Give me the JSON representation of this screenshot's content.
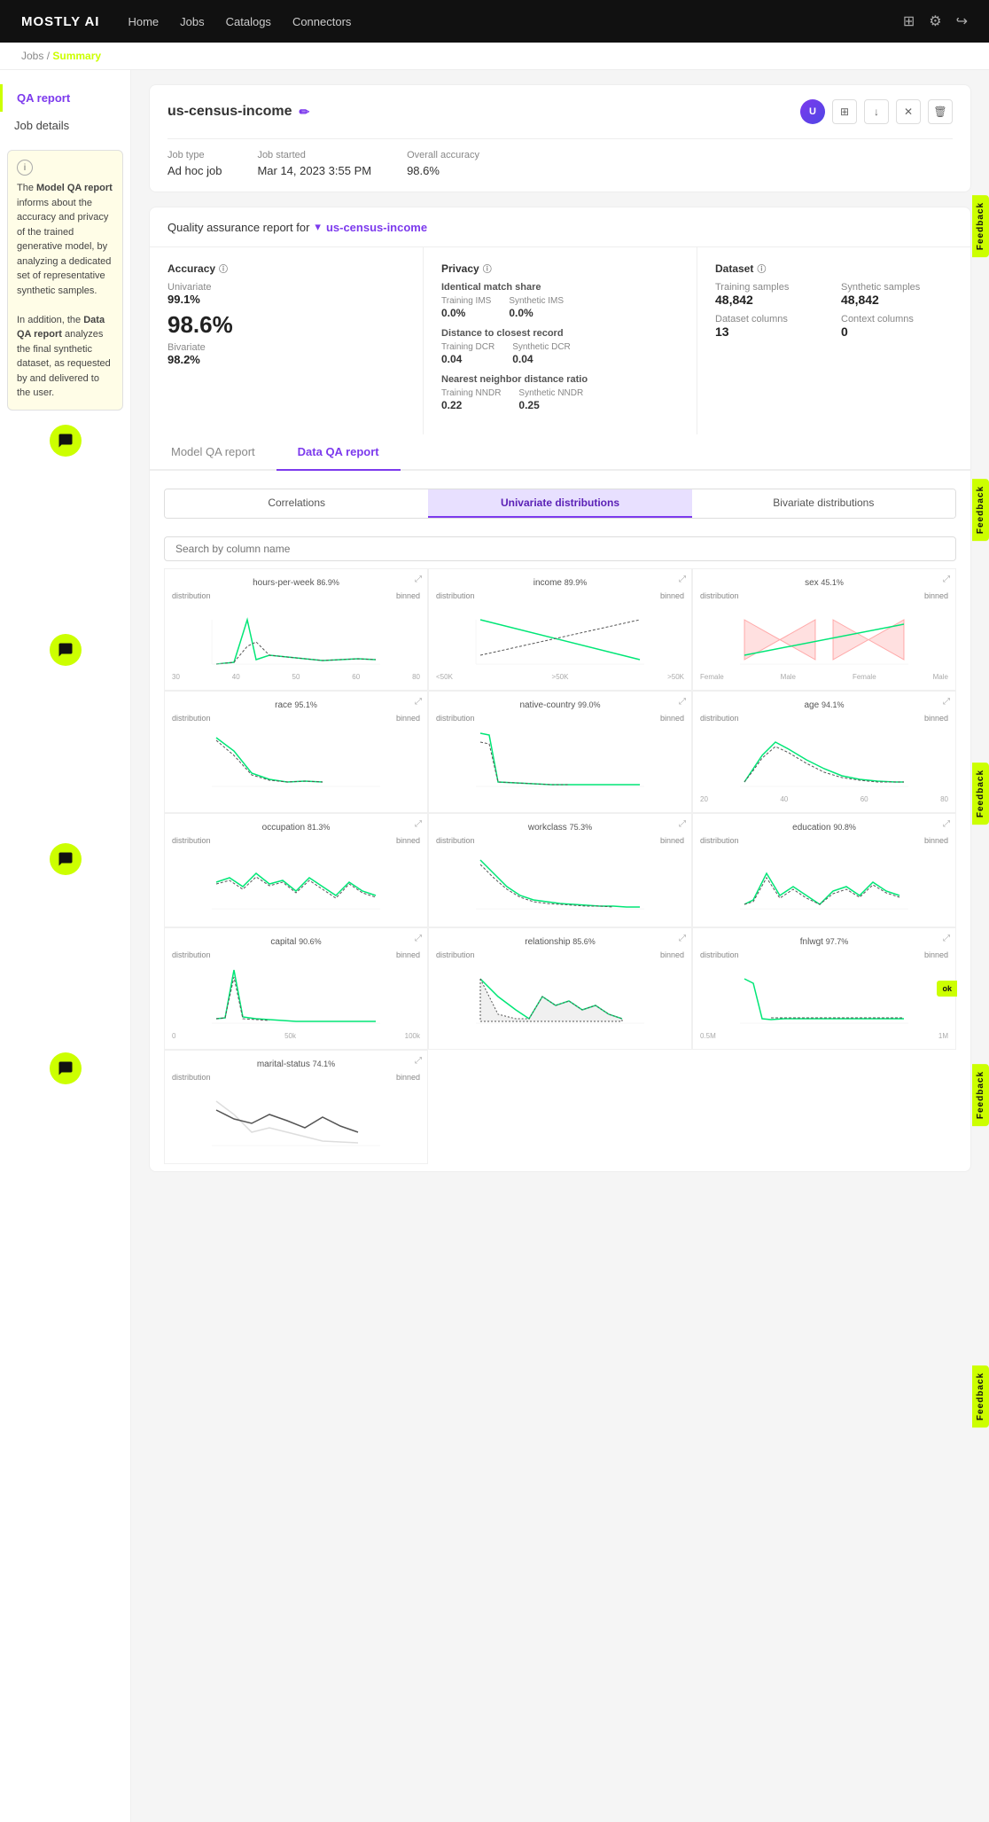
{
  "navbar": {
    "logo": "MOSTLY AI",
    "links": [
      "Home",
      "Jobs",
      "Catalogs",
      "Connectors"
    ]
  },
  "breadcrumb": {
    "jobs": "Jobs",
    "separator": "/",
    "active": "Summary"
  },
  "sidebar": {
    "qa_report": "QA report",
    "job_details": "Job details",
    "info_text_1": "The ",
    "info_bold_1": "Model QA report",
    "info_text_2": " informs about the accuracy and privacy of the trained generative model, by analyzing a dedicated set of representative synthetic samples.",
    "info_text_3": "In addition, the ",
    "info_bold_2": "Data QA report",
    "info_text_4": " analyzes the final synthetic dataset, as requested by and delivered to the user."
  },
  "report": {
    "title": "us-census-income",
    "job_type_label": "Job type",
    "job_type_value": "Ad hoc job",
    "job_started_label": "Job started",
    "job_started_value": "Mar 14, 2023 3:55 PM",
    "overall_accuracy_label": "Overall accuracy",
    "overall_accuracy_value": "98.6%"
  },
  "qa_report": {
    "header_text": "Quality assurance report for",
    "dataset_link": "us-census-income",
    "accuracy": {
      "title": "Accuracy",
      "univariate_label": "Univariate",
      "univariate_value": "99.1%",
      "bivariate_label": "Bivariate",
      "bivariate_value": "98.2%",
      "big_value": "98.6%"
    },
    "privacy": {
      "title": "Privacy",
      "identical_match_share": "Identical match share",
      "training_ims_label": "Training IMS",
      "training_ims_value": "0.0%",
      "synthetic_ims_label": "Synthetic IMS",
      "synthetic_ims_value": "0.0%",
      "distance_label": "Distance to closest record",
      "training_dcr_label": "Training DCR",
      "training_dcr_value": "0.04",
      "synthetic_dcr_label": "Synthetic DCR",
      "synthetic_dcr_value": "0.04",
      "nndr_label": "Nearest neighbor distance ratio",
      "training_nndr_label": "Training NNDR",
      "training_nndr_value": "0.22",
      "synthetic_nndr_label": "Synthetic NNDR",
      "synthetic_nndr_value": "0.25"
    },
    "dataset": {
      "title": "Dataset",
      "training_samples_label": "Training samples",
      "training_samples_value": "48,842",
      "synthetic_samples_label": "Synthetic samples",
      "synthetic_samples_value": "48,842",
      "dataset_columns_label": "Dataset columns",
      "dataset_columns_value": "13",
      "context_columns_label": "Context columns",
      "context_columns_value": "0"
    }
  },
  "tabs": {
    "model_qa": "Model QA report",
    "data_qa": "Data QA report"
  },
  "sub_tabs": {
    "correlations": "Correlations",
    "univariate": "Univariate distributions",
    "bivariate": "Bivariate distributions"
  },
  "search": {
    "placeholder": "Search by column name"
  },
  "charts": [
    {
      "name": "hours-per-week",
      "accuracy": "86.9%",
      "type": "line_spike"
    },
    {
      "name": "income",
      "accuracy": "89.9%",
      "type": "line_diagonal"
    },
    {
      "name": "sex",
      "accuracy": "45.1%",
      "type": "crossing_lines"
    },
    {
      "name": "race",
      "accuracy": "95.1%",
      "type": "line_decay"
    },
    {
      "name": "native-country",
      "accuracy": "99.0%",
      "type": "line_tall_spike"
    },
    {
      "name": "age",
      "accuracy": "94.1%",
      "type": "line_bell"
    },
    {
      "name": "occupation",
      "accuracy": "81.3%",
      "type": "line_flat_spiky"
    },
    {
      "name": "workclass",
      "accuracy": "75.3%",
      "type": "line_decay2"
    },
    {
      "name": "education",
      "accuracy": "90.8%",
      "type": "line_multi"
    },
    {
      "name": "capital",
      "accuracy": "90.6%",
      "type": "line_spike2"
    },
    {
      "name": "relationship",
      "accuracy": "85.6%",
      "type": "line_irregular"
    },
    {
      "name": "fnlwgt",
      "accuracy": "97.7%",
      "type": "line_flat_end"
    },
    {
      "name": "marital-status",
      "accuracy": "74.1%",
      "type": "line_decay3"
    }
  ],
  "feedback_label": "Feedback",
  "ok_label": "ok"
}
